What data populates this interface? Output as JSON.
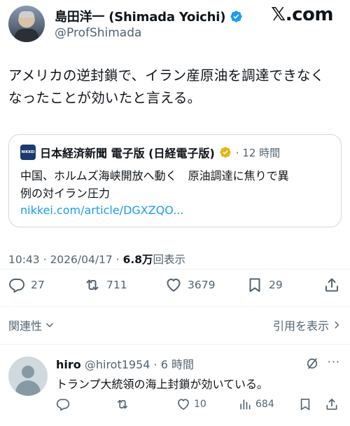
{
  "author": {
    "display_name": "島田洋一 (Shimada Yoichi)",
    "handle": "@ProfShimada",
    "verified_icon": "verified-badge-icon"
  },
  "brand": {
    "logo_text": "𝕏.com"
  },
  "tweet": {
    "text_line1": "アメリカの逆封鎖で、イラン産原油を調達できなく",
    "text_line2": "なったことが効いたと言える。",
    "timestamp": "10:43 · 2026/04/17 ·",
    "views_count": "6.8万",
    "views_label": "回表示"
  },
  "card": {
    "logo_text": "NIKKEI",
    "source": "日本経済新聞 電子版 (日経電子版)",
    "time": "· 12 時間",
    "title_line1": "中国、ホルムズ海峡開放へ動く　原油調達に焦りで異",
    "title_line2": "例の対イラン圧力",
    "link": "nikkei.com/article/DGXZQO..."
  },
  "actions": {
    "replies": "27",
    "reposts": "711",
    "likes": "3679",
    "bookmarks": "29"
  },
  "sort": {
    "left_label": "関連性",
    "right_label": "引用を表示"
  },
  "reply": {
    "name": "hiro",
    "handle": "@hirot1954",
    "time": "· 6 時間",
    "text": "トランプ大統領の海上封鎖が効いている。",
    "likes": "10",
    "views": "684",
    "more": "···"
  },
  "colors": {
    "text": "#0f1419",
    "secondary": "#536471",
    "link": "#1d9bf0",
    "border": "#cfd9de",
    "verified_blue": "#1d9bf0",
    "verified_gold": "#e2b719"
  }
}
